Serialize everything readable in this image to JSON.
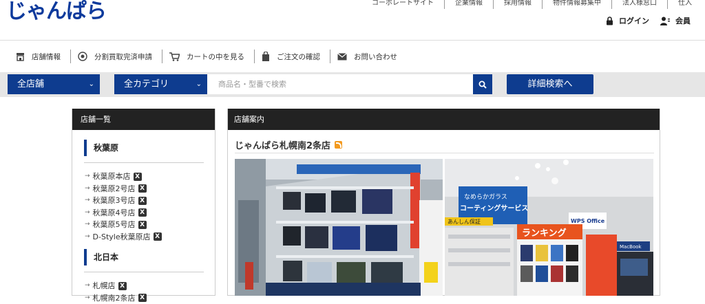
{
  "header": {
    "logo_text": "じゃんぱら",
    "top_links": [
      "コーポレートサイト",
      "企業情報",
      "採用情報",
      "物件情報募集中",
      "法人様窓口",
      "仕入"
    ],
    "login_label": "ログイン",
    "member_label": "会員"
  },
  "subnav": {
    "items": [
      {
        "label": "店舗情報",
        "icon": "store-icon"
      },
      {
        "label": "分割買取完済申請",
        "icon": "circle-check-icon"
      },
      {
        "label": "カートの中を見る",
        "icon": "cart-icon"
      },
      {
        "label": "ご注文の確認",
        "icon": "bag-icon"
      },
      {
        "label": "お問い合わせ",
        "icon": "mail-icon"
      }
    ]
  },
  "search": {
    "store_select": "全店舗",
    "category_select": "全カテゴリ",
    "placeholder": "商品名・型番で検索",
    "advanced_label": "詳細検索へ"
  },
  "sidebar": {
    "title": "店舗一覧",
    "regions": [
      {
        "name": "秋葉原",
        "stores": [
          "秋葉原本店",
          "秋葉原2号店",
          "秋葉原3号店",
          "秋葉原4号店",
          "秋葉原5号店",
          "D-Style秋葉原店"
        ]
      },
      {
        "name": "北日本",
        "stores": [
          "札幌店",
          "札幌南2条店"
        ]
      }
    ],
    "badge_char": "X"
  },
  "main": {
    "title": "店舗案内",
    "store_name": "じゃんぱら札幌南2条店"
  },
  "photos": {
    "right_sign_1": "なめらかガラス",
    "right_sign_2": "コーティングサービス",
    "right_sign_3": "あんしん保証",
    "right_sign_4": "ランキング",
    "right_sign_5": "WPS Office",
    "right_sign_6": "MacBook"
  },
  "colors": {
    "brand_blue": "#0e3c8f",
    "logo_blue": "#0d3a9c",
    "header_black": "#222222",
    "rss_orange": "#f39a1f"
  }
}
